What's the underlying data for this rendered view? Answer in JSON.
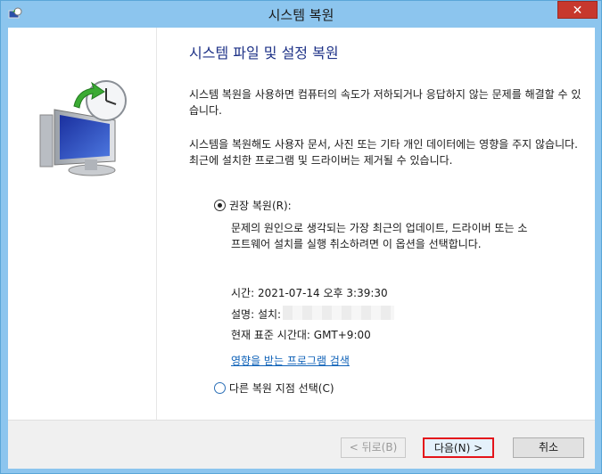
{
  "window": {
    "title": "시스템 복원",
    "close_label": "✕"
  },
  "content": {
    "heading": "시스템 파일 및 설정 복원",
    "para1": "시스템 복원을 사용하면 컴퓨터의 속도가 저하되거나 응답하지 않는 문제를 해결할 수 있습니다.",
    "para2": "시스템을 복원해도 사용자 문서, 사진 또는 기타 개인 데이터에는 영향을 주지 않습니다. 최근에 설치한 프로그램 및 드라이버는 제거될 수 있습니다.",
    "recommended_label": "권장 복원(R):",
    "recommended_desc": "문제의 원인으로 생각되는 가장 최근의 업데이트, 드라이버 또는 소프트웨어 설치를 실행 취소하려면 이 옵션을 선택합니다.",
    "time": "시간: 2021-07-14 오후 3:39:30",
    "description": "설명: 설치:",
    "timezone": "현재 표준 시간대: GMT+9:00",
    "affected_link": "영향을 받는 프로그램 검색",
    "other_label": "다른 복원 지점 선택(C)"
  },
  "buttons": {
    "back": "< 뒤로(B)",
    "next": "다음(N) >",
    "cancel": "취소"
  }
}
